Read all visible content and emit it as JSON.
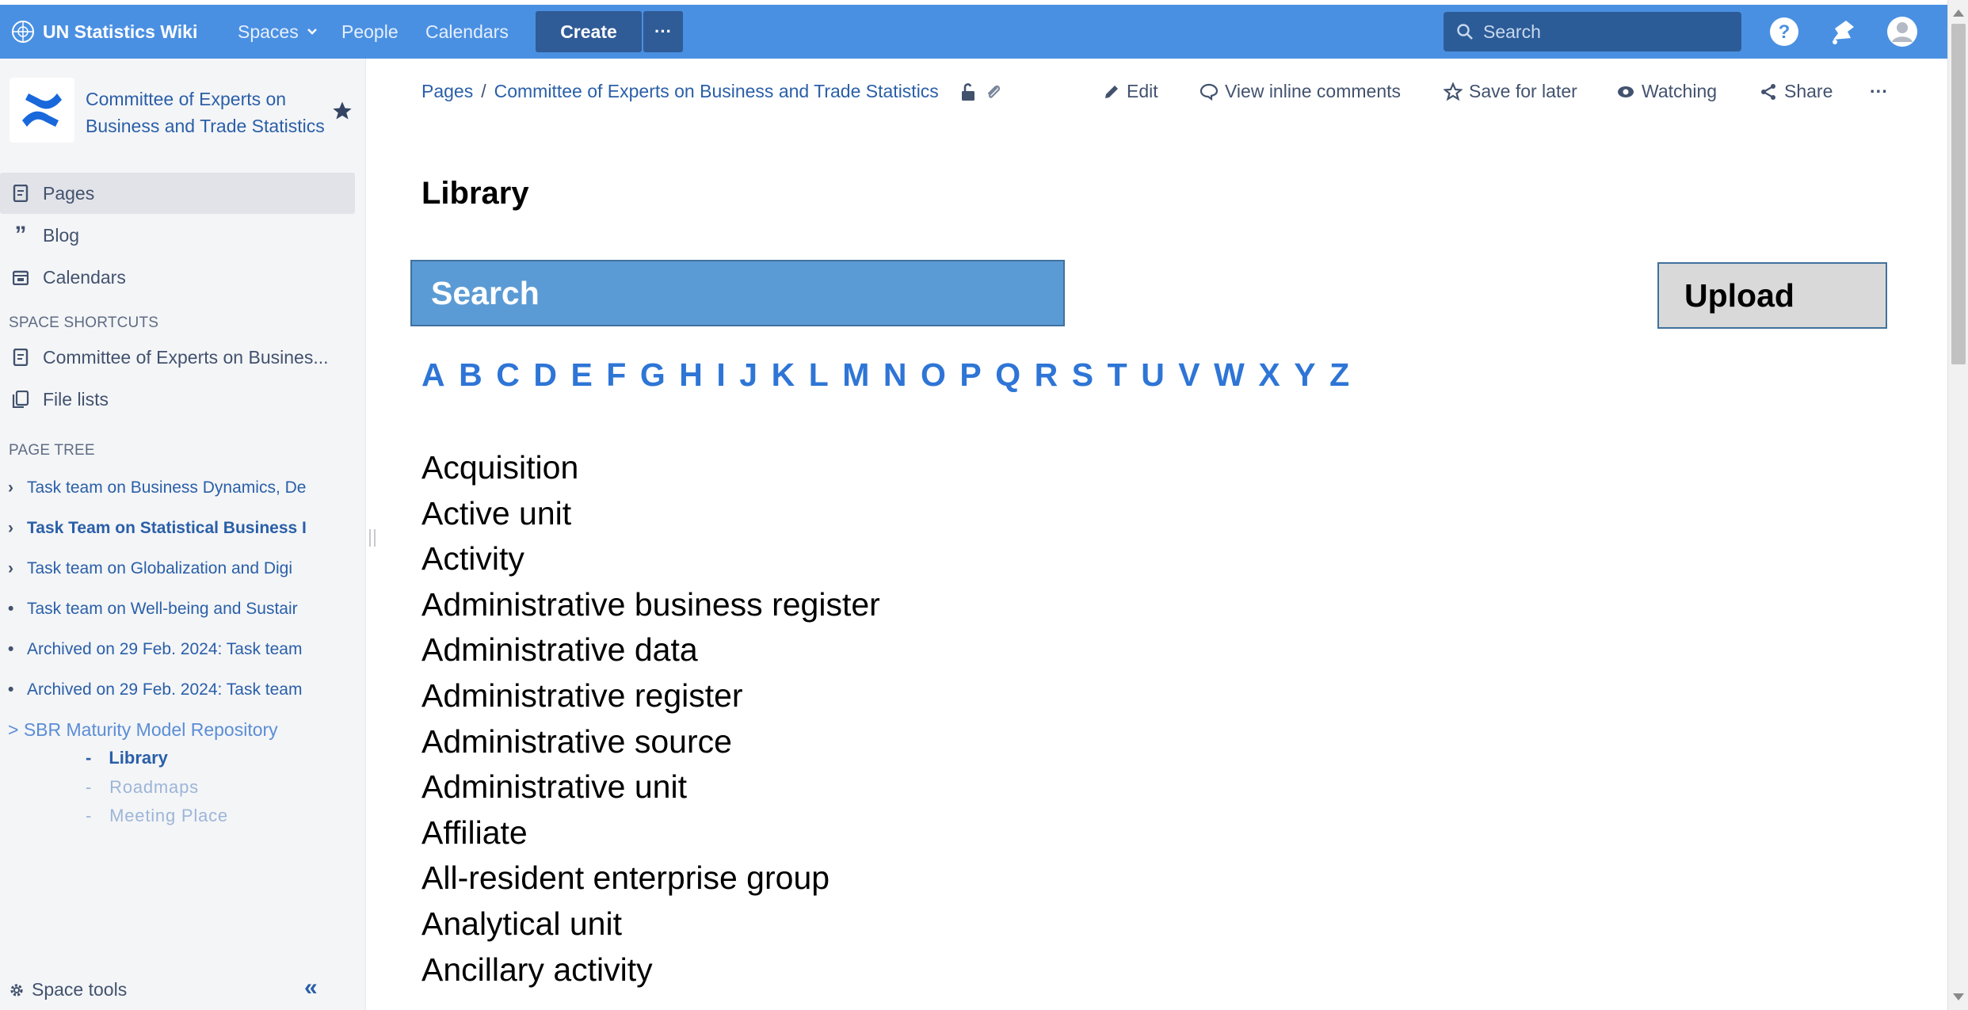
{
  "topbar": {
    "app_title": "UN Statistics Wiki",
    "nav": [
      "Spaces",
      "People",
      "Calendars"
    ],
    "create_label": "Create",
    "more_label": "···",
    "search_placeholder": "Search"
  },
  "sidebar": {
    "space_name": "Committee of Experts on Business and Trade Statistics",
    "items": [
      "Pages",
      "Blog",
      "Calendars"
    ],
    "shortcuts_heading": "SPACE SHORTCUTS",
    "shortcuts": [
      "Committee of Experts on Busines...",
      "File lists"
    ],
    "page_tree_heading": "PAGE TREE",
    "tree": [
      {
        "marker": "›",
        "label": "Task team on Business Dynamics, De"
      },
      {
        "marker": "›",
        "label": "Task Team on Statistical Business I"
      },
      {
        "marker": "›",
        "label": "Task team on Globalization and Digi"
      },
      {
        "marker": "•",
        "label": "Task team on Well-being and Sustair"
      },
      {
        "marker": "•",
        "label": "Archived on 29 Feb. 2024: Task team"
      },
      {
        "marker": "•",
        "label": "Archived on 29 Feb. 2024: Task team"
      }
    ],
    "sbr_repository": "> SBR Maturity Model Repository",
    "sub_items": [
      "Library",
      "Roadmaps",
      "Meeting Place"
    ],
    "space_tools": "Space tools",
    "collapse": "«"
  },
  "breadcrumb": {
    "root": "Pages",
    "separator": "/",
    "parent": "Committee of Experts on Business and Trade Statistics"
  },
  "page_actions": {
    "edit": "Edit",
    "comments": "View inline comments",
    "save": "Save for later",
    "watching": "Watching",
    "share": "Share",
    "more": "···"
  },
  "content": {
    "title": "Library",
    "search_button": "Search",
    "upload_button": "Upload",
    "alphabet": [
      "A",
      "B",
      "C",
      "D",
      "E",
      "F",
      "G",
      "H",
      "I",
      "J",
      "K",
      "L",
      "M",
      "N",
      "O",
      "P",
      "Q",
      "R",
      "S",
      "T",
      "U",
      "V",
      "W",
      "X",
      "Y",
      "Z"
    ],
    "terms": [
      "Acquisition",
      "Active unit",
      "Activity",
      "Administrative business register",
      "Administrative data",
      "Administrative register",
      "Administrative source",
      "Administrative unit",
      "Affiliate",
      "All-resident enterprise group",
      "Analytical unit",
      "Ancillary activity"
    ]
  },
  "colors": {
    "topbar": "#4a90e2",
    "create_button": "#2f5b97",
    "link": "#2a5fa8",
    "alphabet": "#2e75d6",
    "search_button": "#5b9bd5",
    "upload_button": "#d9d9d9"
  }
}
